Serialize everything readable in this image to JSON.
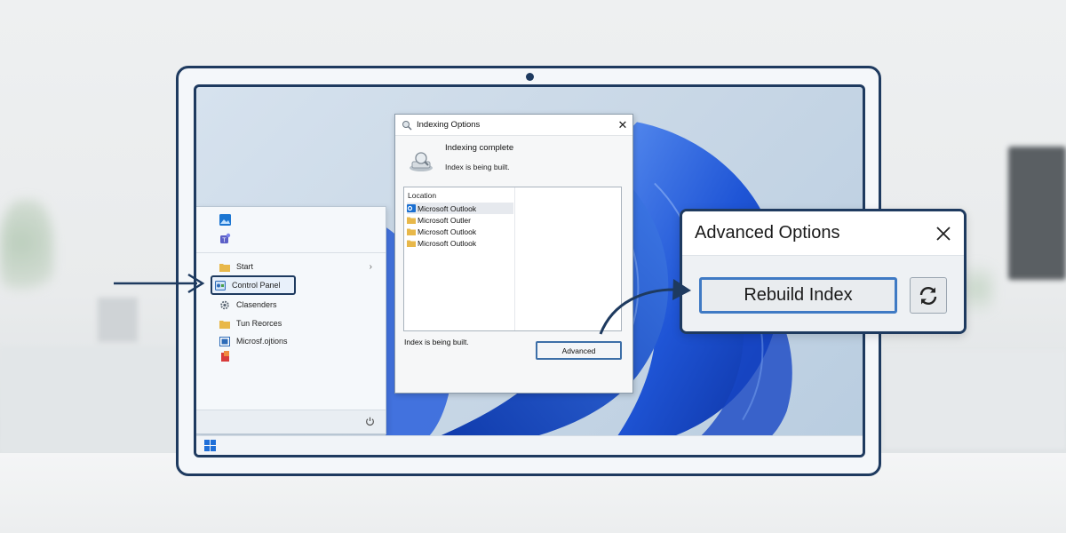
{
  "start_menu": {
    "items": [
      {
        "label": "Start",
        "icon": "folder-icon"
      },
      {
        "label": "Control Panel",
        "icon": "control-panel-icon"
      },
      {
        "label": "Clasenders",
        "icon": "gear-icon"
      },
      {
        "label": "Tun Reorces",
        "icon": "folder-icon"
      },
      {
        "label": "Microsf.ojtions",
        "icon": "settings-app-icon"
      }
    ],
    "pinned_icons": [
      "photos-app-icon",
      "teams-app-icon",
      "office-app-icon"
    ],
    "power_icon": "power-icon"
  },
  "indexing_dialog": {
    "title": "Indexing Options",
    "status_heading": "Indexing complete",
    "status_detail": "Index is being built.",
    "location_header": "Location",
    "locations": [
      {
        "label": "Microsoft Outlook",
        "icon": "outlook-icon",
        "selected": true
      },
      {
        "label": "Microsoft Outler",
        "icon": "folder-icon",
        "selected": false
      },
      {
        "label": "Microsoft Outlook",
        "icon": "folder-icon",
        "selected": false
      },
      {
        "label": "Microsoft Outlook",
        "icon": "folder-icon",
        "selected": false
      }
    ],
    "footer_status": "Index is being built.",
    "advanced_button": "Advanced"
  },
  "advanced_options": {
    "title": "Advanced Options",
    "rebuild_button": "Rebuild Index",
    "refresh_icon": "refresh-icon"
  },
  "colors": {
    "frame": "#1e3a5f",
    "accent": "#1f6fd8",
    "button_border": "#3f7ac4",
    "folder": "#e8b84a"
  }
}
